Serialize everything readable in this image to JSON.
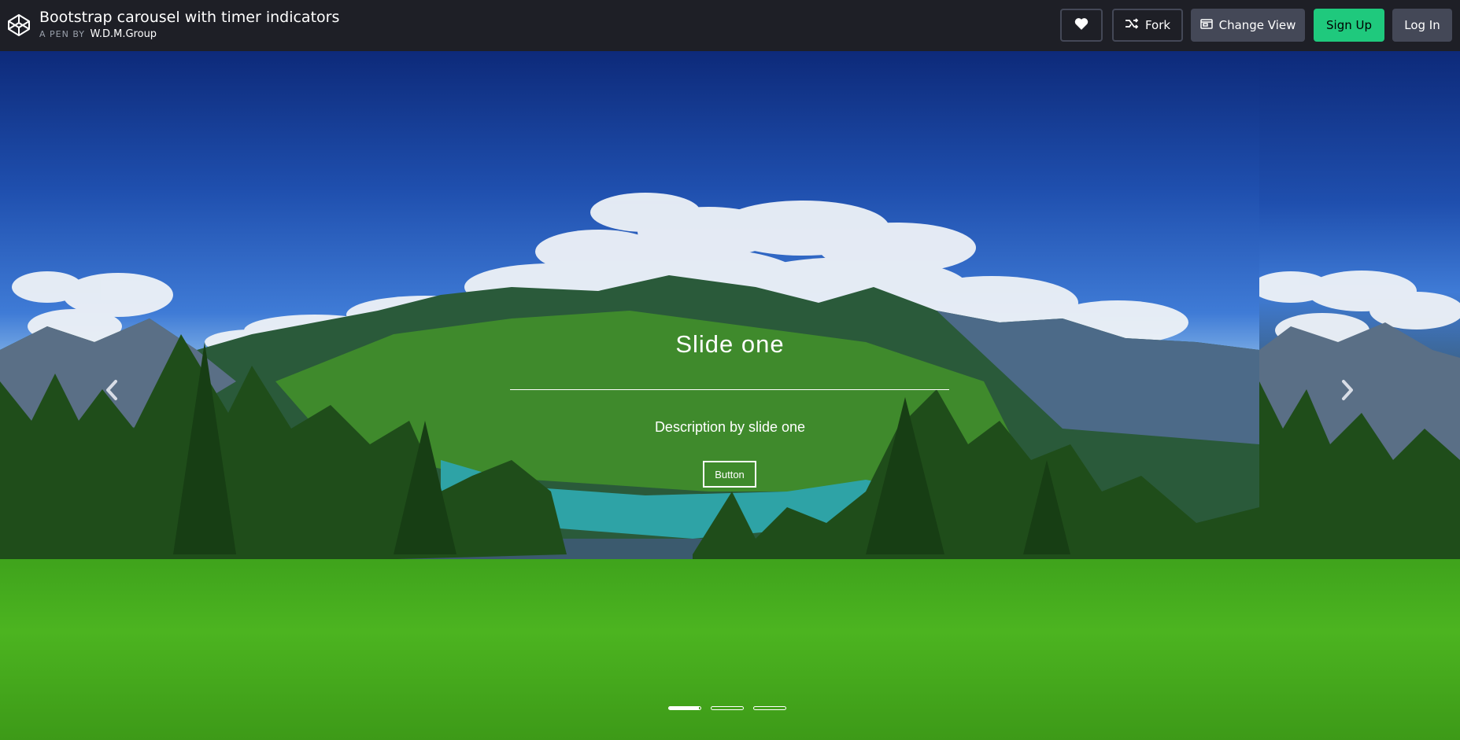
{
  "header": {
    "title": "Bootstrap carousel with timer indicators",
    "byline_prefix": "A PEN BY",
    "author": "W.D.M.Group",
    "fork_label": "Fork",
    "change_view_label": "Change View",
    "signup_label": "Sign Up",
    "login_label": "Log In"
  },
  "carousel": {
    "slide_title": "Slide one",
    "slide_description": "Description by slide one",
    "button_label": "Button",
    "indicators": [
      {
        "progress": 0.95
      },
      {
        "progress": 0
      },
      {
        "progress": 0
      }
    ]
  },
  "colors": {
    "topbar_bg": "#1e1f26",
    "signup_accent": "#1fc97d",
    "button_gray": "#444857"
  },
  "icons": {
    "logo": "codepen-logo-icon",
    "heart": "heart-icon",
    "fork": "fork-icon",
    "change_view": "layout-icon",
    "prev": "chevron-left-icon",
    "next": "chevron-right-icon"
  }
}
